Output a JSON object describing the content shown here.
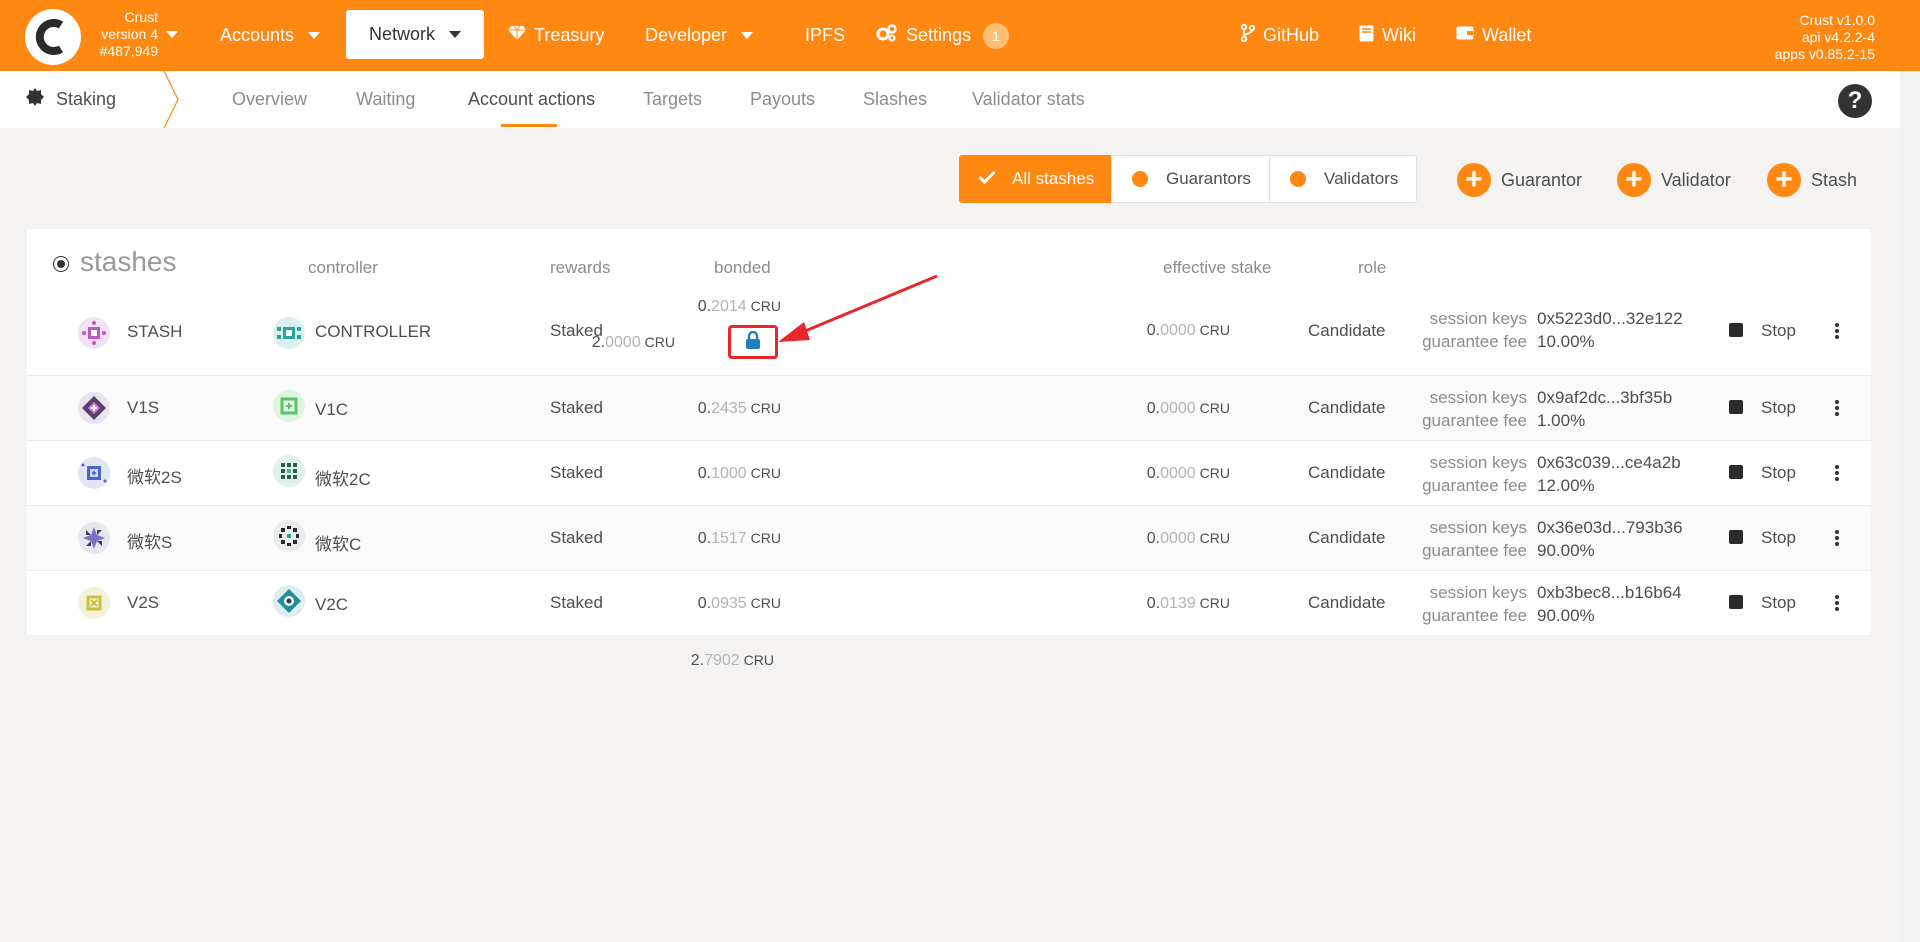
{
  "chain": {
    "name": "Crust",
    "version": "version 4",
    "block": "#487,949"
  },
  "nav": {
    "accounts": "Accounts",
    "network": "Network",
    "treasury": "Treasury",
    "developer": "Developer",
    "ipfs": "IPFS",
    "settings": "Settings",
    "settings_badge": "1",
    "github": "GitHub",
    "wiki": "Wiki",
    "wallet": "Wallet"
  },
  "versions": {
    "crust": "Crust v1.0.0",
    "api": "api v4.2.2-4",
    "apps": "apps v0.85.2-15"
  },
  "subnav": {
    "title": "Staking",
    "tabs": [
      "Overview",
      "Waiting",
      "Account actions",
      "Targets",
      "Payouts",
      "Slashes",
      "Validator stats"
    ],
    "active": "Account actions"
  },
  "filters": {
    "all": "All stashes",
    "guarantors": "Guarantors",
    "validators": "Validators"
  },
  "actions": {
    "guarantor": "Guarantor",
    "validator": "Validator",
    "stash": "Stash"
  },
  "table": {
    "headers": {
      "stashes": "stashes",
      "controller": "controller",
      "rewards": "rewards",
      "bonded": "bonded",
      "effective": "effective stake",
      "role": "role"
    },
    "labels": {
      "session_keys": "session keys",
      "guarantee_fee": "guarantee fee",
      "stop": "Stop",
      "unit": "CRU"
    },
    "rows": [
      {
        "stash": "STASH",
        "controller": "CONTROLLER",
        "rewards": "Staked",
        "bonded_int": "0.",
        "bonded_dec": "2014",
        "locked_int": "2.",
        "locked_dec": "0000",
        "eff_int": "0.",
        "eff_dec": "0000",
        "role": "Candidate",
        "session_keys": "0x5223d0...32e122",
        "fee": "10.00%"
      },
      {
        "stash": "V1S",
        "controller": "V1C",
        "rewards": "Staked",
        "bonded_int": "0.",
        "bonded_dec": "2435",
        "eff_int": "0.",
        "eff_dec": "0000",
        "role": "Candidate",
        "session_keys": "0x9af2dc...3bf35b",
        "fee": "1.00%"
      },
      {
        "stash": "微软2S",
        "controller": "微软2C",
        "rewards": "Staked",
        "bonded_int": "0.",
        "bonded_dec": "1000",
        "eff_int": "0.",
        "eff_dec": "0000",
        "role": "Candidate",
        "session_keys": "0x63c039...ce4a2b",
        "fee": "12.00%"
      },
      {
        "stash": "微软S",
        "controller": "微软C",
        "rewards": "Staked",
        "bonded_int": "0.",
        "bonded_dec": "1517",
        "eff_int": "0.",
        "eff_dec": "0000",
        "role": "Candidate",
        "session_keys": "0x36e03d...793b36",
        "fee": "90.00%"
      },
      {
        "stash": "V2S",
        "controller": "V2C",
        "rewards": "Staked",
        "bonded_int": "0.",
        "bonded_dec": "0935",
        "eff_int": "0.",
        "eff_dec": "0139",
        "role": "Candidate",
        "session_keys": "0xb3bec8...b16b64",
        "fee": "90.00%"
      }
    ],
    "total_int": "2.",
    "total_dec": "7902"
  },
  "colors": {
    "accent": "#ff8812",
    "annotation": "#e8262b",
    "lock": "#1f7fbf"
  }
}
